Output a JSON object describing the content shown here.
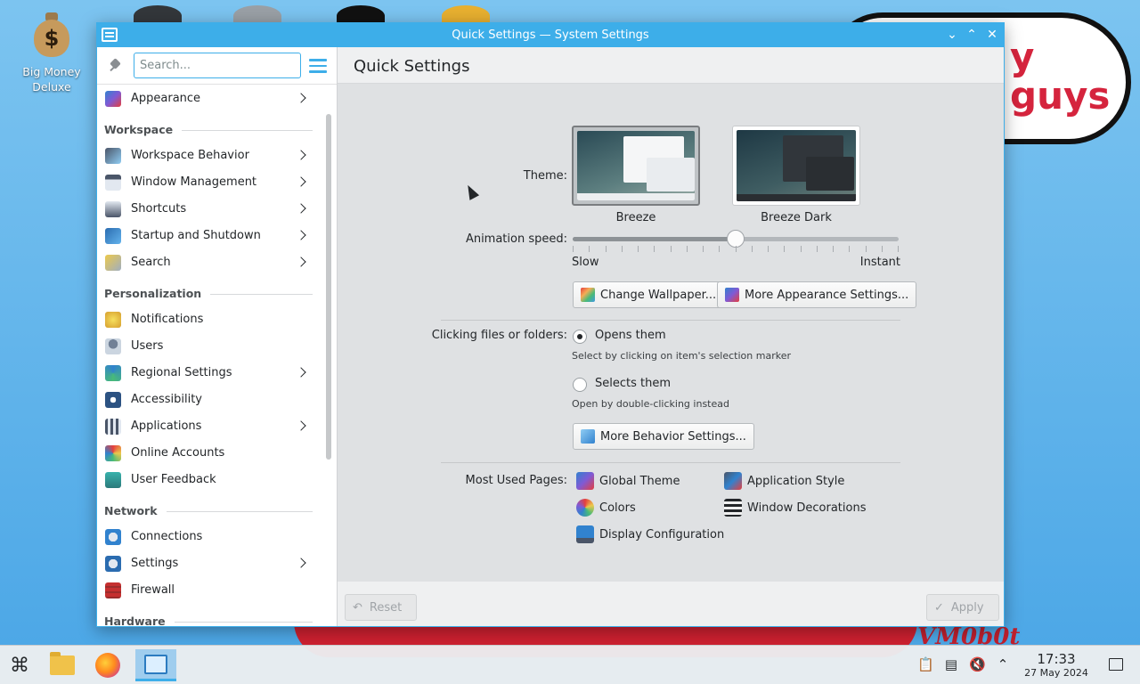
{
  "desktop": {
    "icon_label_line1": "Big Money",
    "icon_label_line2": "Deluxe",
    "bubble_line1": "y",
    "bubble_line2": "guys",
    "signature": "VM0b0t"
  },
  "window": {
    "title": "Quick Settings — System Settings",
    "buttons": {
      "minimize": "⌄",
      "maximize": "⌃",
      "close": "✕"
    }
  },
  "sidebar": {
    "search_placeholder": "Search...",
    "items": [
      {
        "type": "item",
        "label": "Appearance",
        "chevron": true
      },
      {
        "type": "category",
        "label": "Workspace"
      },
      {
        "type": "item",
        "label": "Workspace Behavior",
        "chevron": true
      },
      {
        "type": "item",
        "label": "Window Management",
        "chevron": true
      },
      {
        "type": "item",
        "label": "Shortcuts",
        "chevron": true
      },
      {
        "type": "item",
        "label": "Startup and Shutdown",
        "chevron": true
      },
      {
        "type": "item",
        "label": "Search",
        "chevron": true
      },
      {
        "type": "category",
        "label": "Personalization"
      },
      {
        "type": "item",
        "label": "Notifications",
        "chevron": false
      },
      {
        "type": "item",
        "label": "Users",
        "chevron": false
      },
      {
        "type": "item",
        "label": "Regional Settings",
        "chevron": true
      },
      {
        "type": "item",
        "label": "Accessibility",
        "chevron": false
      },
      {
        "type": "item",
        "label": "Applications",
        "chevron": true
      },
      {
        "type": "item",
        "label": "Online Accounts",
        "chevron": false
      },
      {
        "type": "item",
        "label": "User Feedback",
        "chevron": false
      },
      {
        "type": "category",
        "label": "Network"
      },
      {
        "type": "item",
        "label": "Connections",
        "chevron": false
      },
      {
        "type": "item",
        "label": "Settings",
        "chevron": true
      },
      {
        "type": "item",
        "label": "Firewall",
        "chevron": false
      },
      {
        "type": "category",
        "label": "Hardware"
      }
    ]
  },
  "main": {
    "page_title": "Quick Settings",
    "theme_label": "Theme:",
    "themes": [
      {
        "name": "Breeze",
        "selected": true
      },
      {
        "name": "Breeze Dark",
        "selected": false
      }
    ],
    "animation_label": "Animation speed:",
    "animation_speed": 0.5,
    "slider_min_label": "Slow",
    "slider_max_label": "Instant",
    "change_wallpaper": "Change Wallpaper...",
    "more_appearance": "More Appearance Settings...",
    "clicking_label": "Clicking files or folders:",
    "opens_label": "Opens them",
    "opens_hint": "Select by clicking on item's selection marker",
    "selects_label": "Selects them",
    "selects_hint": "Open by double-clicking instead",
    "click_mode_selected": "Opens them",
    "more_behavior": "More Behavior Settings...",
    "most_used_label": "Most Used Pages:",
    "most_used": [
      "Global Theme",
      "Application Style",
      "Colors",
      "Window Decorations",
      "Display Configuration"
    ],
    "reset_label": "Reset",
    "apply_label": "Apply"
  },
  "taskbar": {
    "time": "17:33",
    "date": "27 May 2024"
  },
  "colors": {
    "accent": "#3daee9",
    "window_bg": "#eff0f1",
    "text": "#232629"
  }
}
